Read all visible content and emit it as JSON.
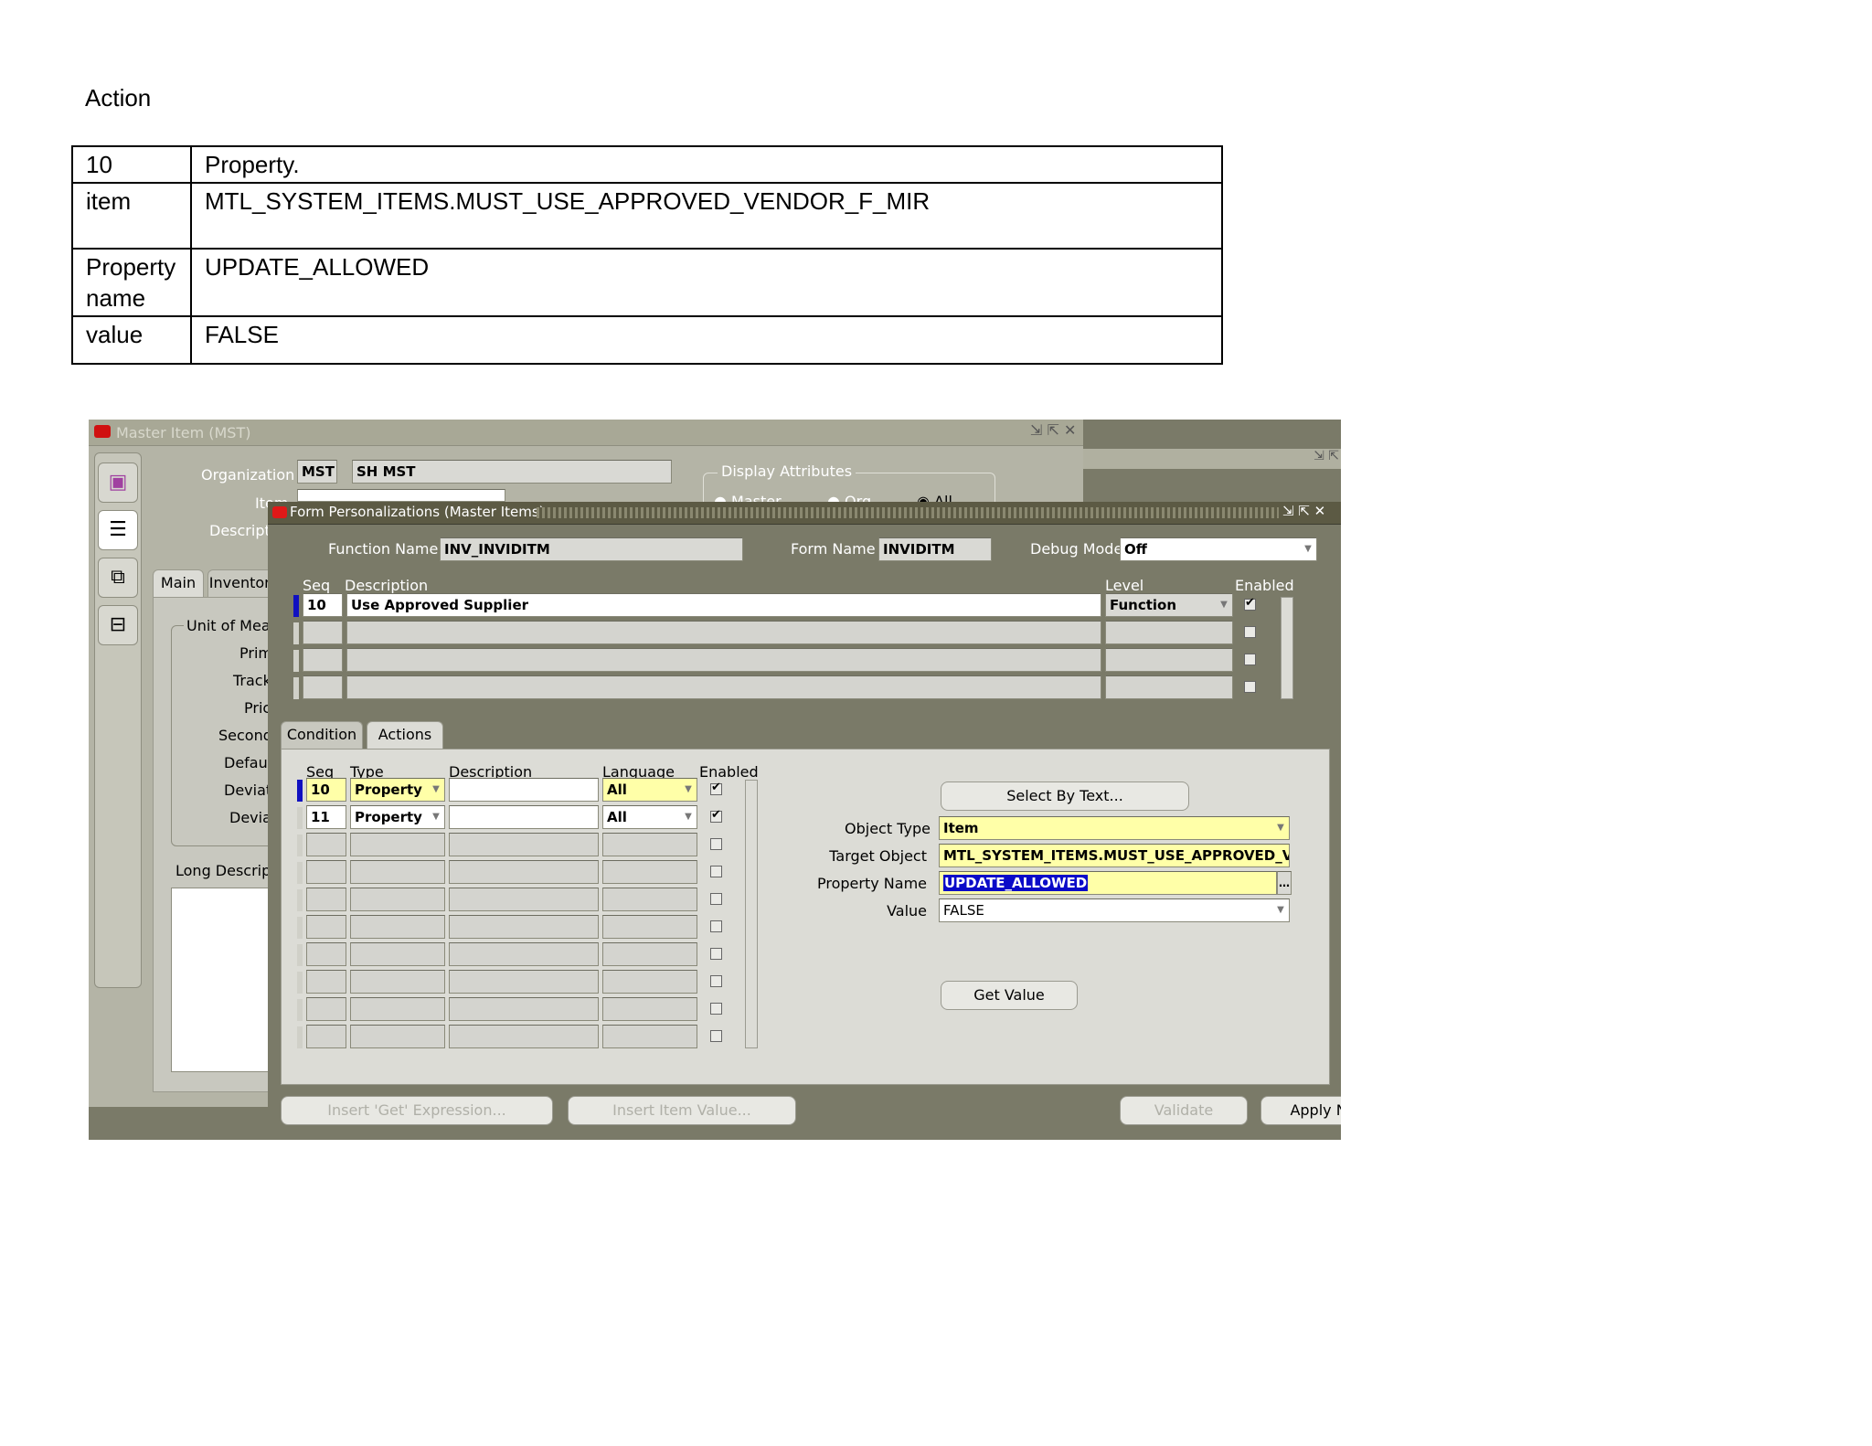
{
  "doc": {
    "heading": "Action",
    "rows": [
      {
        "key": "10",
        "value": "Property."
      },
      {
        "key": "item",
        "value": "MTL_SYSTEM_ITEMS.MUST_USE_APPROVED_VENDOR_F_MIR"
      },
      {
        "key": "Property name",
        "value": "UPDATE_ALLOWED"
      },
      {
        "key": "value",
        "value": "FALSE"
      }
    ]
  },
  "back_window": {
    "title": "Master Item (MST)",
    "organization_label": "Organization",
    "organization_code": "MST",
    "organization_name": "SH MST",
    "item_label": "Item",
    "description_label": "Descripti",
    "display_attributes_label": "Display Attributes",
    "radio_options": [
      "Master",
      "Org",
      "All"
    ],
    "tabs": [
      "Main",
      "Inventory"
    ],
    "uom_group_label": "Unit of Meas",
    "side_labels": [
      "Prim",
      "Track",
      "Pric",
      "Second",
      "Defaul",
      "Deviati",
      "Deviat"
    ],
    "long_description_label": "Long Descript"
  },
  "dialog": {
    "title": "Form Personalizations (Master Items)",
    "function_name_label": "Function Name",
    "function_name": "INV_INVIDITM",
    "form_name_label": "Form Name",
    "form_name": "INVIDITM",
    "debug_mode_label": "Debug Mode",
    "debug_mode": "Off",
    "rules_headers": {
      "seq": "Seq",
      "description": "Description",
      "level": "Level",
      "enabled": "Enabled"
    },
    "rules": [
      {
        "seq": "10",
        "description": "Use Approved Supplier",
        "level": "Function",
        "enabled": true
      }
    ],
    "tabs": [
      "Condition",
      "Actions"
    ],
    "actions_headers": {
      "seq": "Seq",
      "type": "Type",
      "description": "Description",
      "language": "Language",
      "enabled": "Enabled"
    },
    "actions": [
      {
        "seq": "10",
        "type": "Property",
        "description": "",
        "language": "All",
        "enabled": true
      },
      {
        "seq": "11",
        "type": "Property",
        "description": "",
        "language": "All",
        "enabled": true
      }
    ],
    "select_by_text_button": "Select By Text...",
    "object_type_label": "Object Type",
    "object_type": "Item",
    "target_object_label": "Target Object",
    "target_object": "MTL_SYSTEM_ITEMS.MUST_USE_APPROVED_V",
    "property_name_label": "Property Name",
    "property_name": "UPDATE_ALLOWED",
    "value_label": "Value",
    "value": "FALSE",
    "get_value_button": "Get Value",
    "insert_get_expression_button": "Insert 'Get' Expression...",
    "insert_item_value_button": "Insert Item Value...",
    "validate_button": "Validate",
    "apply_now_button": "Apply Now"
  }
}
